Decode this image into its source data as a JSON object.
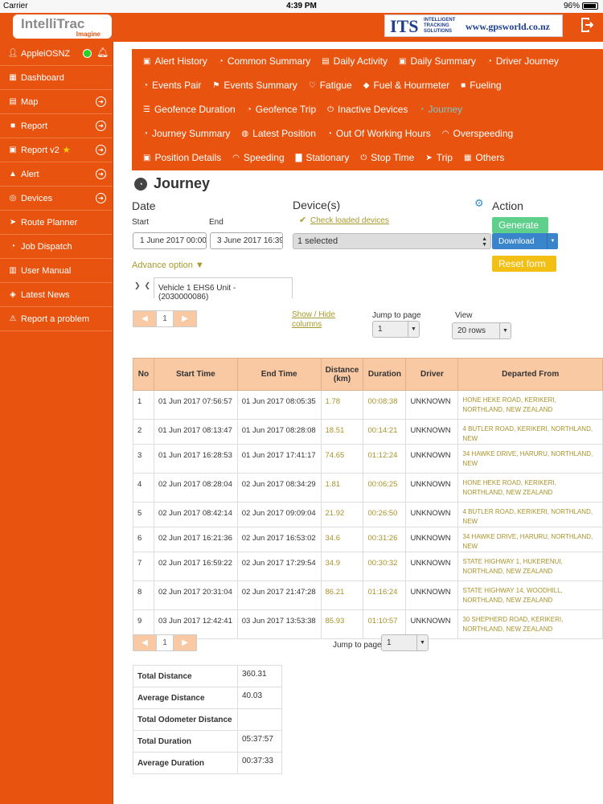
{
  "statusbar": {
    "carrier": "Carrier",
    "time": "4:39 PM",
    "battery": "96%"
  },
  "header": {
    "logo_main": "IntelliTrac",
    "logo_sub": "Imagine",
    "its_letters": "ITS",
    "its_line1": "INTELLIGENT",
    "its_line2": "TRACKING",
    "its_line3": "SOLUTIONS",
    "its_url": "www.gpsworld.co.nz"
  },
  "sidebar": {
    "user": "AppleiOSNZ",
    "items": [
      {
        "label": "Dashboard",
        "icon": "grid-icon",
        "arrow": false
      },
      {
        "label": "Map",
        "icon": "map-icon",
        "arrow": true
      },
      {
        "label": "Report",
        "icon": "report-icon",
        "arrow": true
      },
      {
        "label": "Report v2",
        "icon": "report-icon",
        "arrow": true
      },
      {
        "label": "Alert",
        "icon": "alert-icon",
        "arrow": true
      },
      {
        "label": "Devices",
        "icon": "devices-icon",
        "arrow": true
      },
      {
        "label": "Route Planner",
        "icon": "route-icon",
        "arrow": false
      },
      {
        "label": "Job Dispatch",
        "icon": "job-icon",
        "arrow": false
      },
      {
        "label": "User Manual",
        "icon": "book-icon",
        "arrow": false
      },
      {
        "label": "Latest News",
        "icon": "news-icon",
        "arrow": false
      },
      {
        "label": "Report a problem",
        "icon": "warning-icon",
        "arrow": false
      }
    ]
  },
  "menu": {
    "row1": [
      "Alert History",
      "Common Summary",
      "Daily Activity",
      "Daily Summary",
      "Driver Journey"
    ],
    "row2": [
      "Events Pair",
      "Events Summary",
      "Fatigue",
      "Fuel & Hourmeter",
      "Fueling"
    ],
    "row3": [
      "Geofence Duration",
      "Geofence Trip",
      "Inactive Devices",
      "Journey"
    ],
    "row4": [
      "Journey Summary",
      "Latest Position",
      "Out Of Working Hours",
      "Overspeeding"
    ],
    "row5": [
      "Position Details",
      "Speeding",
      "Stationary",
      "Stop Time",
      "Trip",
      "Others"
    ],
    "active": "Journey"
  },
  "page": {
    "title": "Journey",
    "date_label": "Date",
    "start_label": "Start",
    "end_label": "End",
    "start_value": "1 June 2017 00:00",
    "end_value": "3 June 2017 16:39",
    "devices_label": "Device(s)",
    "check_loaded": "Check loaded devices",
    "devices_selected": "1 selected",
    "action_label": "Action",
    "generate": "Generate",
    "download": "Download",
    "reset": "Reset form",
    "advance_option": "Advance option",
    "vehicle_tab": "Vehicle 1 EHS6 Unit - (2030000086)",
    "show_hide_line1": "Show / Hide",
    "show_hide_line2": "columns",
    "jump_label": "Jump to page",
    "jump_value": "1",
    "view_label": "View",
    "view_value": "20 rows",
    "page_number": "1"
  },
  "table": {
    "headers": [
      "No",
      "Start Time",
      "End Time",
      "Distance (km)",
      "Duration",
      "Driver",
      "Departed From"
    ],
    "rows": [
      [
        "1",
        "01 Jun 2017 07:56:57",
        "01 Jun 2017 08:05:35",
        "1.78",
        "00:08:38",
        "UNKNOWN",
        "HONE HEKE ROAD, KERIKERI, NORTHLAND, NEW ZEALAND"
      ],
      [
        "2",
        "01 Jun 2017 08:13:47",
        "01 Jun 2017 08:28:08",
        "18.51",
        "00:14:21",
        "UNKNOWN",
        "4 BUTLER ROAD, KERIKERI, NORTHLAND, NEW"
      ],
      [
        "3",
        "01 Jun 2017 16:28:53",
        "01 Jun 2017 17:41:17",
        "74.65",
        "01:12:24",
        "UNKNOWN",
        "34 HAWKE DRIVE, HARURU, NORTHLAND, NEW"
      ],
      [
        "4",
        "02 Jun 2017 08:28:04",
        "02 Jun 2017 08:34:29",
        "1.81",
        "00:06:25",
        "UNKNOWN",
        "HONE HEKE ROAD, KERIKERI, NORTHLAND, NEW ZEALAND"
      ],
      [
        "5",
        "02 Jun 2017 08:42:14",
        "02 Jun 2017 09:09:04",
        "21.92",
        "00:26:50",
        "UNKNOWN",
        "4 BUTLER ROAD, KERIKERI, NORTHLAND, NEW"
      ],
      [
        "6",
        "02 Jun 2017 16:21:36",
        "02 Jun 2017 16:53:02",
        "34.6",
        "00:31:26",
        "UNKNOWN",
        "34 HAWKE DRIVE, HARURU, NORTHLAND, NEW"
      ],
      [
        "7",
        "02 Jun 2017 16:59:22",
        "02 Jun 2017 17:29:54",
        "34.9",
        "00:30:32",
        "UNKNOWN",
        "STATE HIGHWAY 1, HUKERENUI, NORTHLAND, NEW ZEALAND"
      ],
      [
        "8",
        "02 Jun 2017 20:31:04",
        "02 Jun 2017 21:47:28",
        "86.21",
        "01:16:24",
        "UNKNOWN",
        "STATE HIGHWAY 14, WOODHILL, NORTHLAND, NEW ZEALAND"
      ],
      [
        "9",
        "03 Jun 2017 12:42:41",
        "03 Jun 2017 13:53:38",
        "85.93",
        "01:10:57",
        "UNKNOWN",
        "30 SHEPHERD ROAD, KERIKERI, NORTHLAND, NEW ZEALAND"
      ]
    ]
  },
  "summary": [
    {
      "label": "Total Distance",
      "value": "360.31"
    },
    {
      "label": "Average Distance",
      "value": "40.03"
    },
    {
      "label": "Total Odometer Distance",
      "value": ""
    },
    {
      "label": "Total Duration",
      "value": "05:37:57"
    },
    {
      "label": "Average Duration",
      "value": "00:37:33"
    }
  ]
}
